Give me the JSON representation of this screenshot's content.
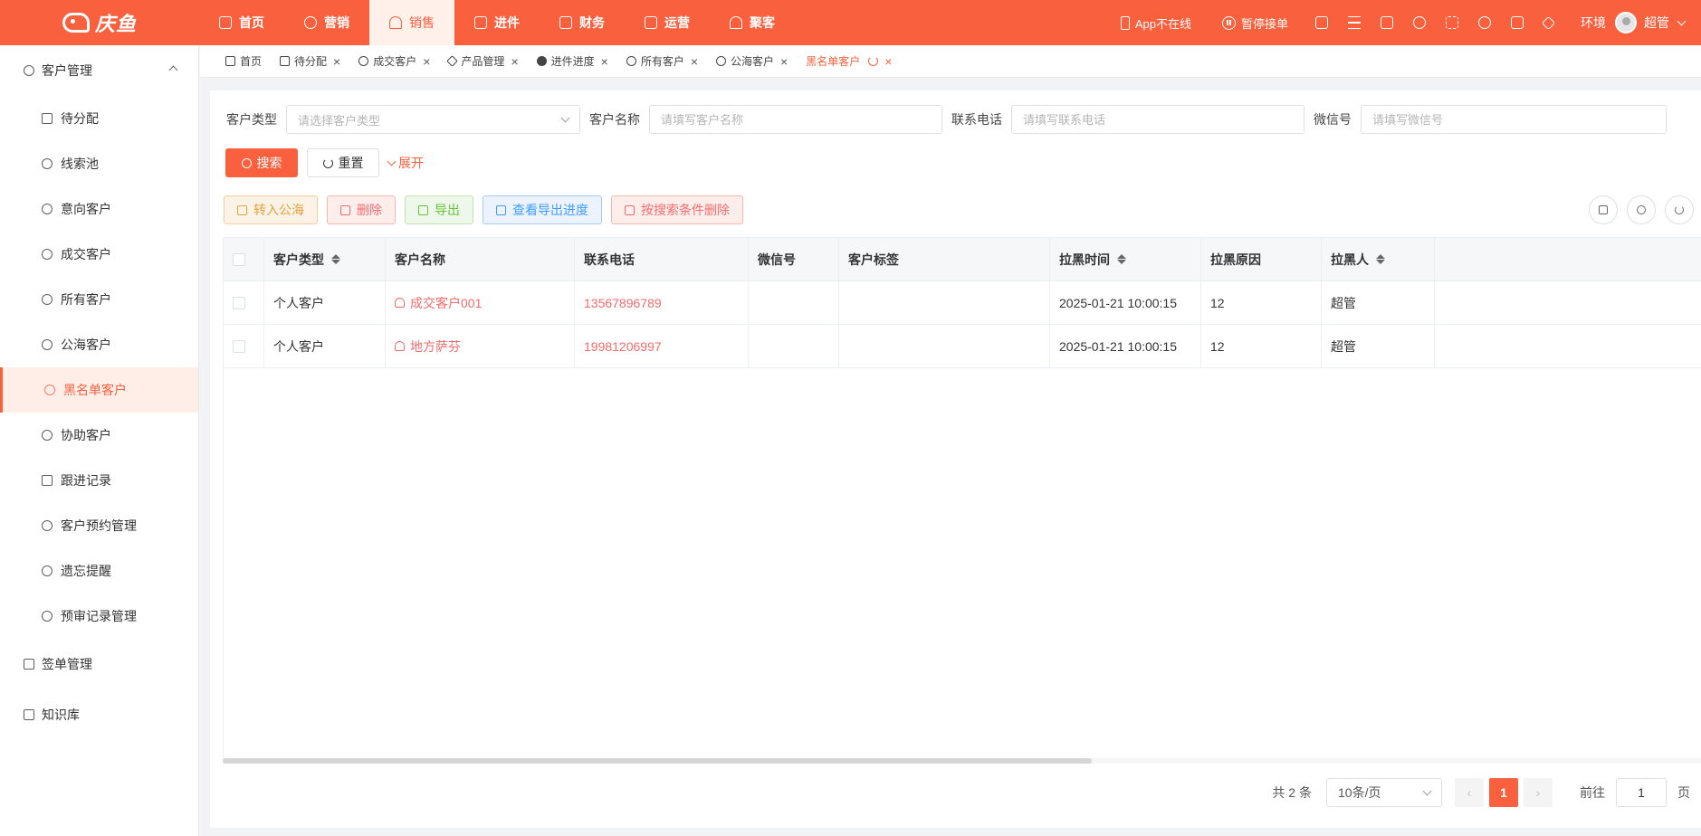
{
  "brand": {
    "name": "庆鱼",
    "color": "#f9603e"
  },
  "topnav": [
    {
      "label": "首页",
      "icon": "home-icon",
      "active": false
    },
    {
      "label": "营销",
      "icon": "marketing-icon",
      "active": false
    },
    {
      "label": "销售",
      "icon": "sales-icon",
      "active": true
    },
    {
      "label": "进件",
      "icon": "document-icon",
      "active": false
    },
    {
      "label": "财务",
      "icon": "finance-icon",
      "active": false
    },
    {
      "label": "运营",
      "icon": "monitor-icon",
      "active": false
    },
    {
      "label": "聚客",
      "icon": "group-icon",
      "active": false
    }
  ],
  "topright": {
    "app_status": "App不在线",
    "pause_label": "暂停接单",
    "env": "环境",
    "user": "超管"
  },
  "sidebar": {
    "group_customer": "客户管理",
    "items": [
      {
        "label": "待分配",
        "icon": "hierarchy-icon"
      },
      {
        "label": "线索池",
        "icon": "clue-icon"
      },
      {
        "label": "意向客户",
        "icon": "user-icon"
      },
      {
        "label": "成交客户",
        "icon": "user-check-icon"
      },
      {
        "label": "所有客户",
        "icon": "users-icon"
      },
      {
        "label": "公海客户",
        "icon": "user-public-icon"
      },
      {
        "label": "黑名单客户",
        "icon": "user-block-icon",
        "active": true
      },
      {
        "label": "协助客户",
        "icon": "user-help-icon"
      },
      {
        "label": "跟进记录",
        "icon": "record-icon"
      },
      {
        "label": "客户预约管理",
        "icon": "calendar-user-icon"
      },
      {
        "label": "遗忘提醒",
        "icon": "alarm-icon"
      },
      {
        "label": "预审记录管理",
        "icon": "audit-icon"
      }
    ],
    "group_sign": "签单管理",
    "group_knowledge": "知识库"
  },
  "tabs": [
    {
      "label": "首页",
      "icon": "home-icon",
      "closable": false
    },
    {
      "label": "待分配",
      "icon": "hierarchy-icon",
      "closable": true
    },
    {
      "label": "成交客户",
      "icon": "user-check-icon",
      "closable": true
    },
    {
      "label": "产品管理",
      "icon": "layers-icon",
      "closable": true
    },
    {
      "label": "进件进度",
      "icon": "pie-icon",
      "closable": true
    },
    {
      "label": "所有客户",
      "icon": "users-icon",
      "closable": true
    },
    {
      "label": "公海客户",
      "icon": "user-public-icon",
      "closable": true
    },
    {
      "label": "黑名单客户",
      "icon": "",
      "closable": true,
      "active": true
    }
  ],
  "search": {
    "type_label": "客户类型",
    "type_placeholder": "请选择客户类型",
    "name_label": "客户名称",
    "name_placeholder": "请填写客户名称",
    "phone_label": "联系电话",
    "phone_placeholder": "请填写联系电话",
    "wechat_label": "微信号",
    "wechat_placeholder": "请填写微信号",
    "search_btn": "搜索",
    "reset_btn": "重置",
    "expand": "展开"
  },
  "actions": {
    "to_public": "转入公海",
    "delete": "删除",
    "export": "导出",
    "export_progress": "查看导出进度",
    "delete_by_condition": "按搜索条件删除"
  },
  "table": {
    "columns": [
      "客户类型",
      "客户名称",
      "联系电话",
      "微信号",
      "客户标签",
      "拉黑时间",
      "拉黑原因",
      "拉黑人"
    ],
    "rows": [
      {
        "type": "个人客户",
        "name": "成交客户001",
        "phone": "13567896789",
        "wechat": "",
        "tags": "",
        "time": "2025-01-21 10:00:15",
        "reason": "12",
        "by": "超管"
      },
      {
        "type": "个人客户",
        "name": "地方萨芬",
        "phone": "19981206997",
        "wechat": "",
        "tags": "",
        "time": "2025-01-21 10:00:15",
        "reason": "12",
        "by": "超管"
      }
    ]
  },
  "pagination": {
    "total": "共 2 条",
    "page_size": "10条/页",
    "current": "1",
    "goto_label": "前往",
    "goto_value": "1",
    "page_unit": "页"
  }
}
